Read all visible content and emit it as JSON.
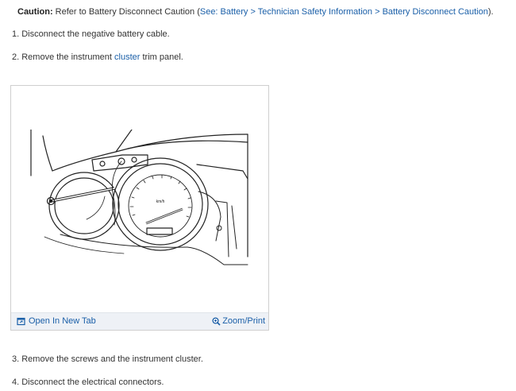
{
  "caution": {
    "label": "Caution:",
    "text": " Refer to Battery Disconnect Caution (",
    "link": "See: Battery > Technician Safety Information > Battery Disconnect Caution",
    "close": ")."
  },
  "steps": [
    {
      "text": "1. Disconnect the negative battery cable."
    },
    {
      "prefix": "2. Remove the instrument ",
      "link": "cluster",
      "suffix": " trim panel."
    },
    {
      "text": "3. Remove the screws and the instrument cluster."
    },
    {
      "text": "4. Disconnect the electrical connectors."
    }
  ],
  "figure": {
    "open_tab_label": "Open In New Tab",
    "zoom_label": "Zoom/Print",
    "speedometer_unit": "km/h"
  },
  "colors": {
    "link": "#1a5fa8",
    "bar": "#eef1f6"
  },
  "icons": {
    "open_tab": "open-new-tab-icon",
    "zoom": "zoom-magnifier-icon"
  }
}
